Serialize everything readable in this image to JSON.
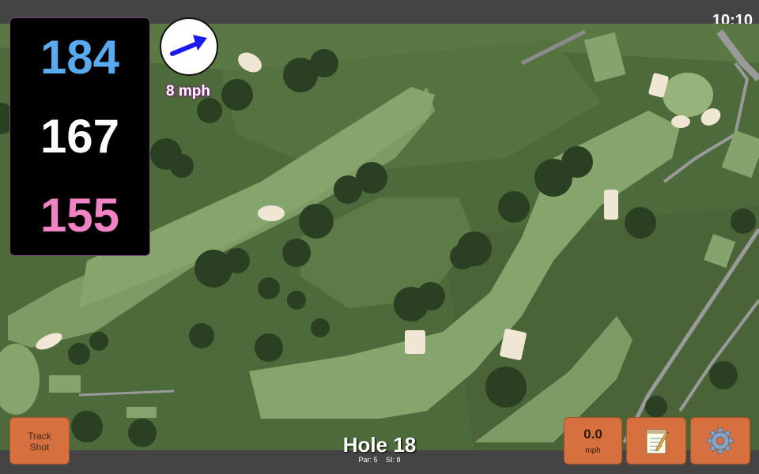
{
  "status": {
    "time": "10:10"
  },
  "distances": {
    "back": "184",
    "middle": "167",
    "front": "155"
  },
  "wind": {
    "speed": "8 mph",
    "arrow_icon": "wind-direction-arrow-icon",
    "arrow_color": "#1a1aee"
  },
  "hole": {
    "title": "Hole 18",
    "par": "Par: 5",
    "si": "SI: 8"
  },
  "buttons": {
    "track_line1": "Track",
    "track_line2": "Shot",
    "shot_speed_value": "0.0",
    "shot_speed_unit": "mph",
    "notes_icon": "notepad-icon",
    "settings_icon": "gear-icon"
  },
  "colors": {
    "back_distance": "#5aaaf0",
    "middle_distance": "#ffffff",
    "front_distance": "#f083c4",
    "button_bg": "#d6703e"
  }
}
